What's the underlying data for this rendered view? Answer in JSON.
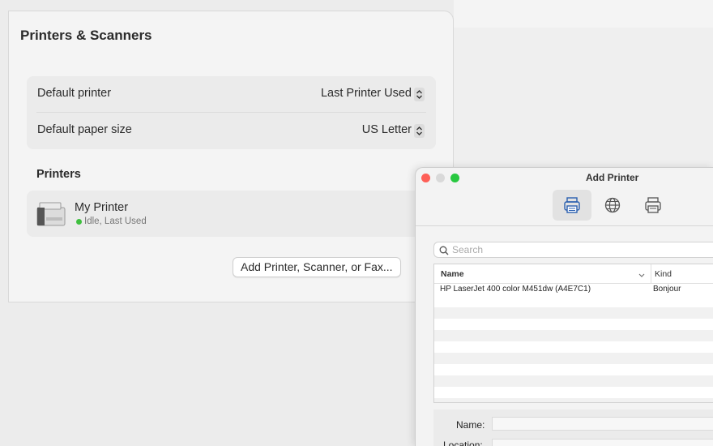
{
  "settings": {
    "title": "Printers & Scanners",
    "rows": [
      {
        "label": "Default printer",
        "value": "Last Printer Used"
      },
      {
        "label": "Default paper size",
        "value": "US Letter"
      }
    ],
    "printers_heading": "Printers",
    "printer": {
      "name": "My Printer",
      "status": "Idle, Last Used",
      "status_color": "#3fbf3f"
    },
    "add_button_label": "Add Printer, Scanner, or Fax..."
  },
  "dialog": {
    "title": "Add Printer",
    "toolbar": [
      {
        "icon": "default-printer-icon",
        "selected": true
      },
      {
        "icon": "ip-globe-icon",
        "selected": false
      },
      {
        "icon": "windows-printer-icon",
        "selected": false
      }
    ],
    "search_placeholder": "Search",
    "columns": {
      "name": "Name",
      "kind": "Kind"
    },
    "rows": [
      {
        "name": "HP LaserJet 400 color M451dw (A4E7C1)",
        "kind": "Bonjour"
      }
    ],
    "form": {
      "name_label": "Name:",
      "location_label": "Location:"
    }
  },
  "colors": {
    "close": "#fe5f57",
    "minimize": "#d9d9d9",
    "zoom": "#28c840"
  }
}
